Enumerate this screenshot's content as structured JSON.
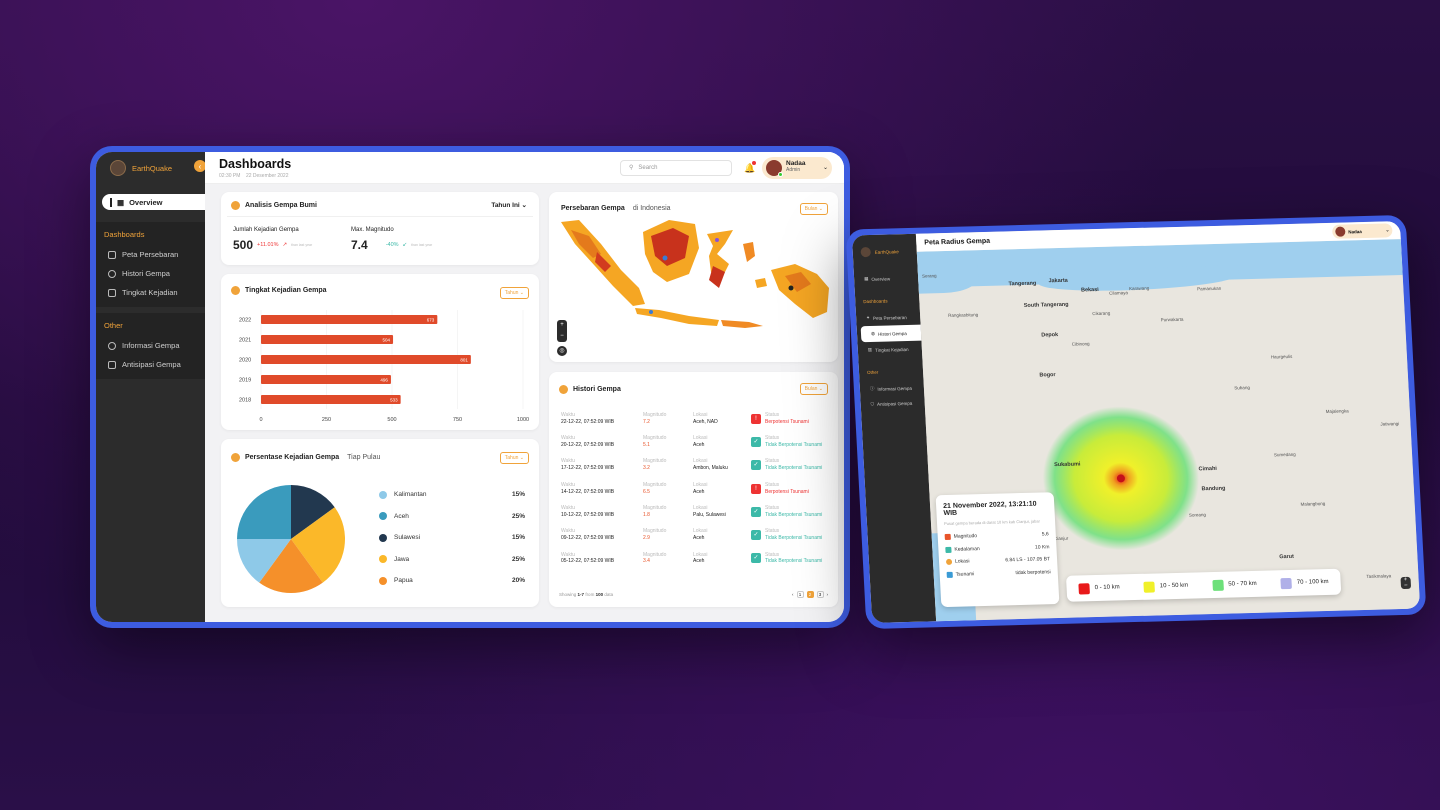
{
  "app": {
    "name": "EarthQuake"
  },
  "sidebar": {
    "overview": "Overview",
    "section1": "Dashboards",
    "items1": [
      "Peta Persebaran",
      "Histori Gempa",
      "Tingkat Kejadian"
    ],
    "section2": "Other",
    "items2": [
      "Informasi Gempa",
      "Antisipasi Gempa"
    ]
  },
  "header": {
    "title": "Dashboards",
    "time": "02:30 PM",
    "date": "22 Desember 2022",
    "search_placeholder": "Search",
    "user_name": "Nadaa",
    "user_role": "Admin"
  },
  "analysis": {
    "title": "Analisis Gempa Bumi",
    "period": "Tahun Ini",
    "count_label": "Jumlah Kejadian Gempa",
    "count_value": "500",
    "count_change": "+11.01%",
    "count_note": "than last year",
    "mag_label": "Max. Magnitudo",
    "mag_value": "7.4",
    "mag_change": "-40%",
    "mag_note": "than last year"
  },
  "rate_chart": {
    "title": "Tingkat Kejadian Gempa",
    "filter": "Tahun"
  },
  "chart_data": [
    {
      "type": "bar",
      "orientation": "horizontal",
      "title": "Tingkat Kejadian Gempa",
      "categories": [
        "2022",
        "2021",
        "2020",
        "2019",
        "2018"
      ],
      "values": [
        673,
        504,
        801,
        496,
        533
      ],
      "xlim": [
        0,
        1000
      ],
      "xticks": [
        "0",
        "250",
        "500",
        "750",
        "1000"
      ],
      "color": "#e04a2a"
    },
    {
      "type": "pie",
      "title": "Persentase Kejadian Gempa",
      "labels": [
        "Kalimantan",
        "Aceh",
        "Sulawesi",
        "Jawa",
        "Papua"
      ],
      "values": [
        15,
        25,
        15,
        25,
        20
      ],
      "colors": [
        "#8ec9e8",
        "#3a9bbd",
        "#22384f",
        "#fbb829",
        "#f5902a"
      ]
    }
  ],
  "percent_card": {
    "title": "Persentase Kejadian Gempa",
    "subtitle": "Tiap Pulau",
    "filter": "Tahun",
    "rows": [
      {
        "label": "Kalimantan",
        "pct": "15%"
      },
      {
        "label": "Aceh",
        "pct": "25%"
      },
      {
        "label": "Sulawesi",
        "pct": "15%"
      },
      {
        "label": "Jawa",
        "pct": "25%"
      },
      {
        "label": "Papua",
        "pct": "20%"
      }
    ]
  },
  "map_card": {
    "title": "Persebaran Gempa",
    "subtitle": "di Indonesia",
    "filter": "Bulan"
  },
  "history": {
    "title": "Histori Gempa",
    "filter": "Bulan",
    "col_time": "Waktu",
    "col_mag": "Magnitudo",
    "col_loc": "Lokasi",
    "col_status": "Status",
    "rows": [
      {
        "time": "22-12-22, 07:52:09 WIB",
        "mag": "7.2",
        "loc": "Aceh, NAD",
        "status": "Berpotensi Tsunami",
        "danger": true
      },
      {
        "time": "20-12-22, 07:52:09 WIB",
        "mag": "5.1",
        "loc": "Aceh",
        "status": "Tidak Berpotensi Tsunami",
        "danger": false
      },
      {
        "time": "17-12-22, 07:52:09 WIB",
        "mag": "3.2",
        "loc": "Ambon, Maluku",
        "status": "Tidak Berpotensi Tsunami",
        "danger": false
      },
      {
        "time": "14-12-22, 07:52:09 WIB",
        "mag": "6.5",
        "loc": "Aceh",
        "status": "Berpotensi Tsunami",
        "danger": true
      },
      {
        "time": "10-12-22, 07:52:09 WIB",
        "mag": "1.8",
        "loc": "Palu, Sulawesi",
        "status": "Tidak Berpotensi Tsunami",
        "danger": false
      },
      {
        "time": "09-12-22, 07:52:09 WIB",
        "mag": "2.9",
        "loc": "Aceh",
        "status": "Tidak Berpotensi Tsunami",
        "danger": false
      },
      {
        "time": "05-12-22, 07:52:09 WIB",
        "mag": "3.4",
        "loc": "Aceh",
        "status": "Tidak Berpotensi Tsunami",
        "danger": false
      }
    ],
    "footer_showing": "Showing",
    "footer_range": "1-7",
    "footer_from": "from",
    "footer_total": "100",
    "footer_data": "data",
    "pages": [
      "1",
      "2",
      "3"
    ],
    "active_page": "2"
  },
  "radius_map": {
    "title": "Peta Radius Gempa",
    "user_name": "Nadaa",
    "cities": [
      "Serang",
      "Tangerang",
      "Jakarta",
      "Bekasi",
      "South Tangerang",
      "Depok",
      "Bogor",
      "Karawang",
      "Pamanukan",
      "Sukabumi",
      "Cimahi",
      "Bandung",
      "Garut",
      "Tasikmalaya",
      "Subang",
      "Purwakarta",
      "Jatiwangi",
      "Haurgeulis",
      "Sumedang",
      "Majalengka",
      "Malangbong",
      "Soreang",
      "Cianjur",
      "Cilamaya",
      "Cikarang",
      "Cibinong",
      "Rangkasbitung",
      "Pelabuhan Ratu"
    ],
    "info": {
      "datetime": "21 November 2022, 13:21:10 WIB",
      "desc": "Pusat gempa berada di darat 10 km kab Cianjur, jabar",
      "mag_label": "Magnitudo",
      "mag_value": "5,6",
      "depth_label": "Kedalaman",
      "depth_value": "10 Km",
      "loc_label": "Lokasi",
      "loc_value": "6.84 LS - 107.05 BT",
      "tsunami_label": "Tsunami",
      "tsunami_value": "tidak berpotensi"
    },
    "legend": [
      "0 - 10 km",
      "10 - 50 km",
      "50 - 70 km",
      "70 - 100 km"
    ],
    "legend_colors": [
      "#e8191a",
      "#f0f02a",
      "#6de07a",
      "#b0b0e8"
    ]
  }
}
